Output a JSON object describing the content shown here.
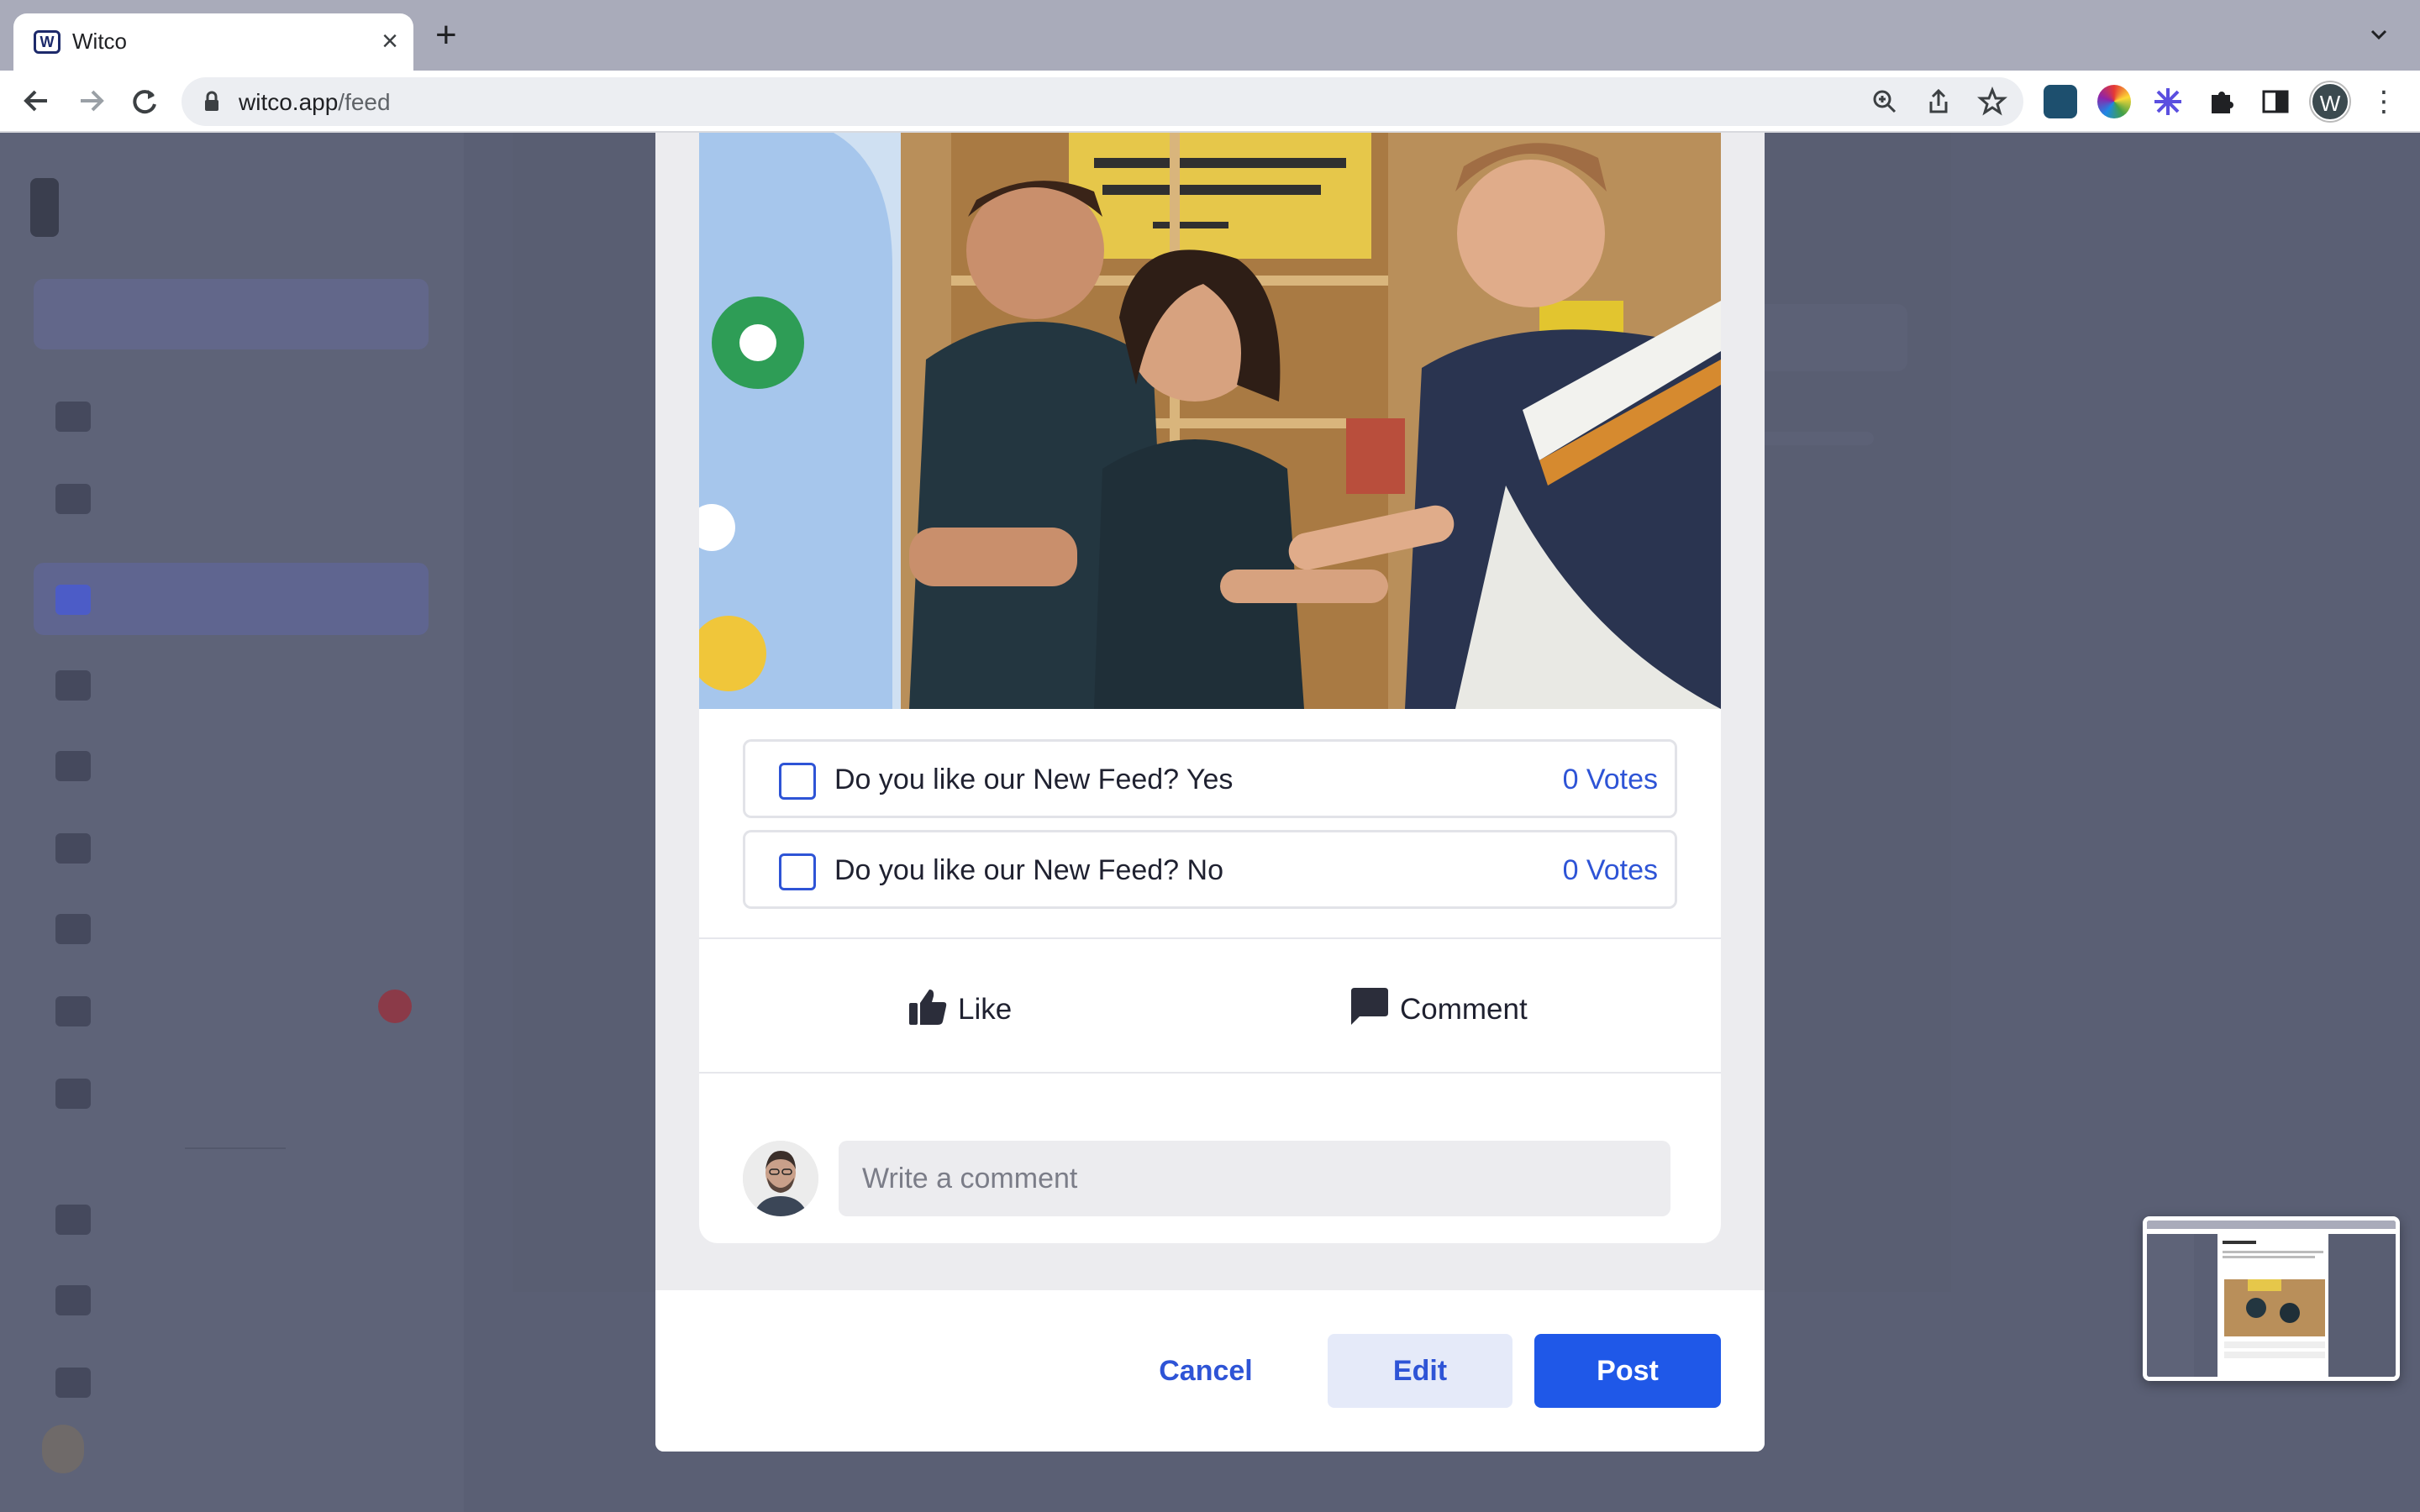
{
  "browser": {
    "tab_title": "Witco",
    "tab_close": "×",
    "new_tab": "+",
    "url_host": "witco.app",
    "url_path": "/feed",
    "profile_initial": "W",
    "icons": [
      "back-arrow-icon",
      "forward-arrow-icon",
      "reload-icon",
      "lock-icon",
      "zoom-icon",
      "share-icon",
      "bookmark-star-icon",
      "extensions-puzzle-icon",
      "side-panel-icon",
      "kebab-menu-icon"
    ]
  },
  "post": {
    "poll": [
      {
        "label": "Do you like our New Feed? Yes",
        "votes": "0 Votes"
      },
      {
        "label": "Do you like our New Feed? No",
        "votes": "0 Votes"
      }
    ],
    "actions": {
      "like": "Like",
      "comment": "Comment"
    },
    "comment_placeholder": "Write a comment"
  },
  "footer": {
    "cancel": "Cancel",
    "edit": "Edit",
    "post": "Post"
  },
  "colors": {
    "accent": "#1f58e8",
    "link": "#2e54d6"
  }
}
